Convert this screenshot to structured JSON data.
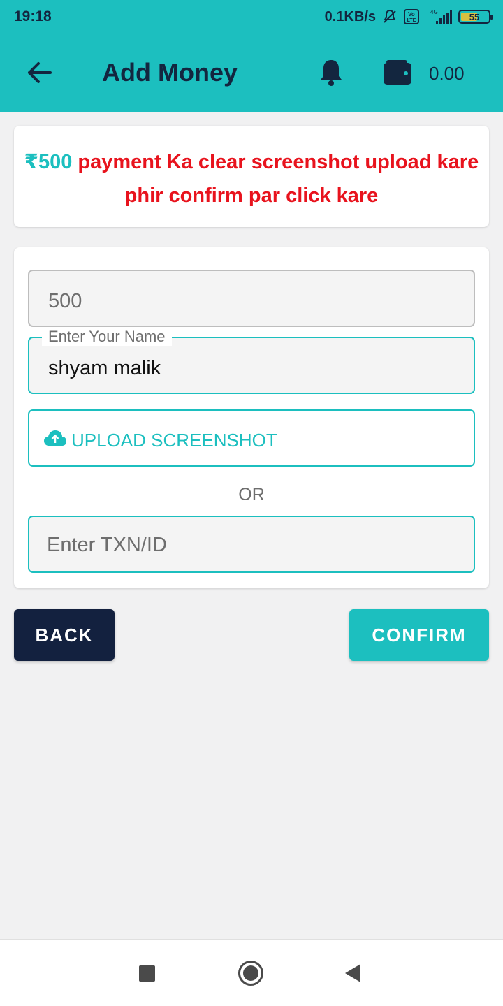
{
  "status_bar": {
    "time": "19:18",
    "net_speed": "0.1KB/s",
    "network": "4G",
    "volte": "Vo LTE",
    "battery": "55"
  },
  "app_bar": {
    "title": "Add Money",
    "balance": "0.00",
    "icons": [
      "back-arrow-icon",
      "bell-icon",
      "wallet-icon"
    ]
  },
  "notice": {
    "amount": "₹500",
    "message": " payment Ka clear screenshot upload kare phir confirm par click kare"
  },
  "form": {
    "amount_value": "500",
    "name_label": "Enter Your Name",
    "name_value": "shyam malik",
    "upload_label": "UPLOAD SCREENSHOT",
    "or_text": "OR",
    "txn_placeholder": "Enter TXN/ID"
  },
  "buttons": {
    "back": "BACK",
    "confirm": "CONFIRM"
  },
  "colors": {
    "accent": "#1cbfbf",
    "dark": "#13213f",
    "alert": "#e8131d"
  }
}
